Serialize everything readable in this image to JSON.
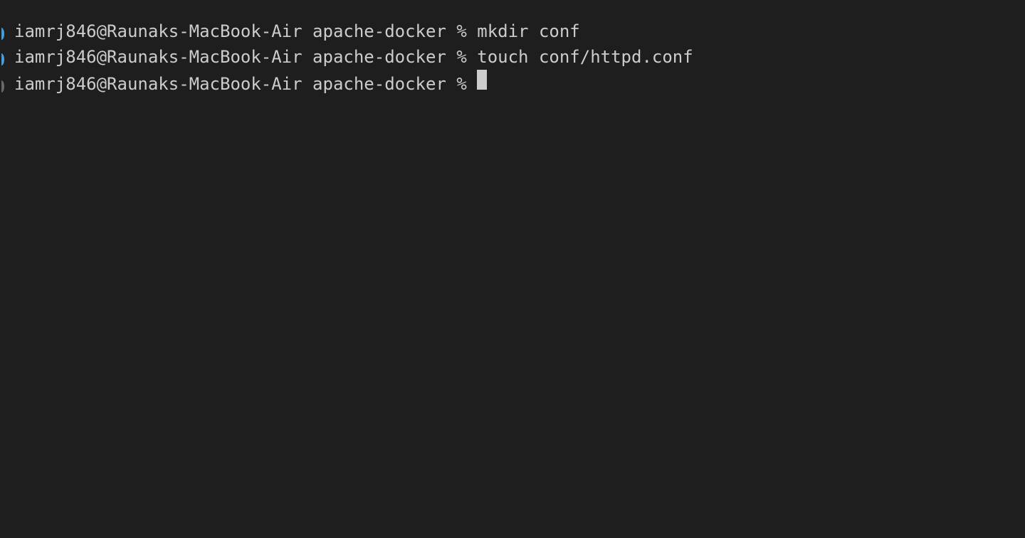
{
  "terminal": {
    "lines": [
      {
        "arrow_active": true,
        "user": "iamrj846",
        "host": "Raunaks-MacBook-Air",
        "cwd": "apache-docker",
        "separator": "%",
        "command": "mkdir conf",
        "has_cursor": false
      },
      {
        "arrow_active": true,
        "user": "iamrj846",
        "host": "Raunaks-MacBook-Air",
        "cwd": "apache-docker",
        "separator": "%",
        "command": "touch conf/httpd.conf",
        "has_cursor": false
      },
      {
        "arrow_active": false,
        "user": "iamrj846",
        "host": "Raunaks-MacBook-Air",
        "cwd": "apache-docker",
        "separator": "%",
        "command": "",
        "has_cursor": true
      }
    ]
  }
}
